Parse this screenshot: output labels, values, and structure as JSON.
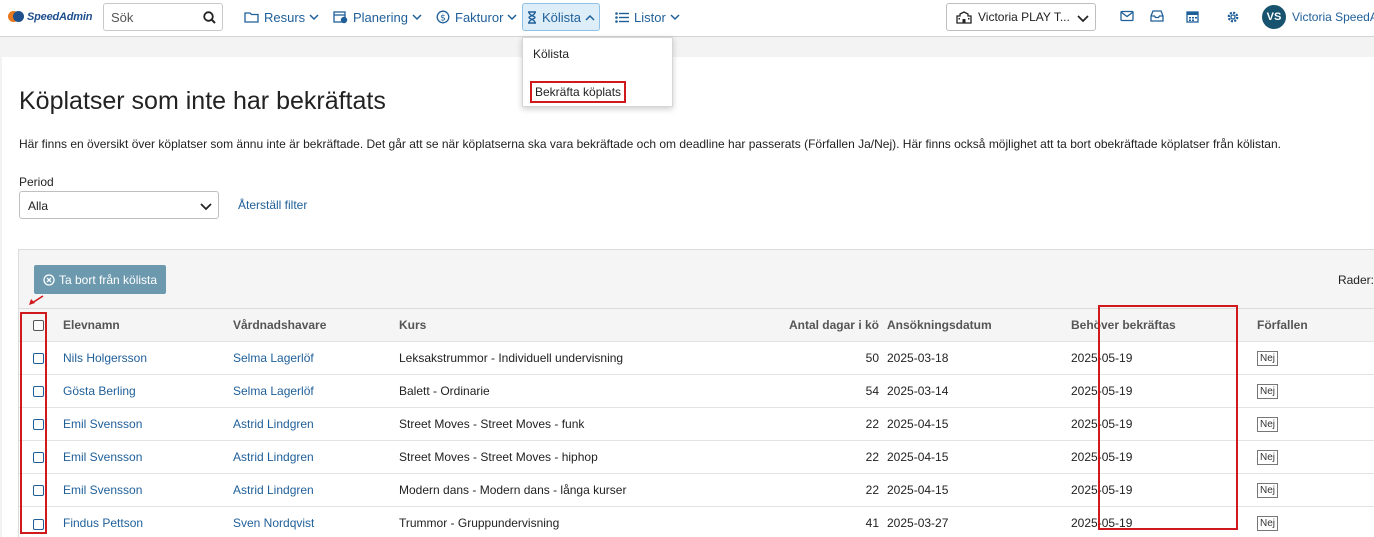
{
  "header": {
    "logo_text": "SpeedAdmin",
    "search": {
      "placeholder": "Sök"
    },
    "nav": [
      {
        "label": "Resurs",
        "icon": "folder-icon"
      },
      {
        "label": "Planering",
        "icon": "calendar-clock-icon"
      },
      {
        "label": "Fakturor",
        "icon": "dollar-circle-icon"
      },
      {
        "label": "Kölista",
        "icon": "hourglass-icon",
        "active": true
      },
      {
        "label": "Listor",
        "icon": "list-icon"
      }
    ],
    "dropdown": [
      {
        "label": "Kölista"
      },
      {
        "label": "Bekräfta köplats",
        "highlighted": true
      }
    ],
    "org_select": "Victoria PLAY T...",
    "icons": [
      "mail-icon",
      "inbox-icon",
      "calendar-icon",
      "gear-icon"
    ],
    "user": {
      "initials": "VS",
      "name": "Victoria SpeedA"
    }
  },
  "main": {
    "title": "Köplatser som inte har bekräftats",
    "description": "Här finns en översikt över köplatser som ännu inte är bekräftade. Det går att se när köplatserna ska vara bekräftade och om deadline har passerats (Förfallen Ja/Nej). Här finns också möjlighet att ta bort obekräftade köplatser från kölistan.",
    "period_label": "Period",
    "period_value": "Alla",
    "reset_filter": "Återställ filter",
    "remove_button": "Ta bort från kölista",
    "rows_label": "Rader:"
  },
  "table": {
    "columns": [
      "Elevnamn",
      "Vårdnadshavare",
      "Kurs",
      "Antal dagar i kö",
      "Ansökningsdatum",
      "Behöver bekräftas",
      "Förfallen"
    ],
    "rows": [
      {
        "name": "Nils Holgersson",
        "guardian": "Selma Lagerlöf",
        "course": "Leksakstrummor - Individuell undervisning",
        "days": "50",
        "applied": "2025-03-18",
        "confirm_by": "2025-05-19",
        "overdue": "Nej"
      },
      {
        "name": "Gösta Berling",
        "guardian": "Selma Lagerlöf",
        "course": "Balett - Ordinarie",
        "days": "54",
        "applied": "2025-03-14",
        "confirm_by": "2025-05-19",
        "overdue": "Nej"
      },
      {
        "name": "Emil Svensson",
        "guardian": "Astrid Lindgren",
        "course": "Street Moves - Street Moves - funk",
        "days": "22",
        "applied": "2025-04-15",
        "confirm_by": "2025-05-19",
        "overdue": "Nej"
      },
      {
        "name": "Emil Svensson",
        "guardian": "Astrid Lindgren",
        "course": "Street Moves - Street Moves - hiphop",
        "days": "22",
        "applied": "2025-04-15",
        "confirm_by": "2025-05-19",
        "overdue": "Nej"
      },
      {
        "name": "Emil Svensson",
        "guardian": "Astrid Lindgren",
        "course": "Modern dans - Modern dans - långa kurser",
        "days": "22",
        "applied": "2025-04-15",
        "confirm_by": "2025-05-19",
        "overdue": "Nej"
      },
      {
        "name": "Findus Pettson",
        "guardian": "Sven Nordqvist",
        "course": "Trummor - Gruppundervisning",
        "days": "41",
        "applied": "2025-03-27",
        "confirm_by": "2025-05-19",
        "overdue": "Nej"
      }
    ]
  },
  "colors": {
    "link": "#1f5f99",
    "highlight": "#d0191c",
    "button": "#6d99ae",
    "avatar": "#17536f"
  }
}
